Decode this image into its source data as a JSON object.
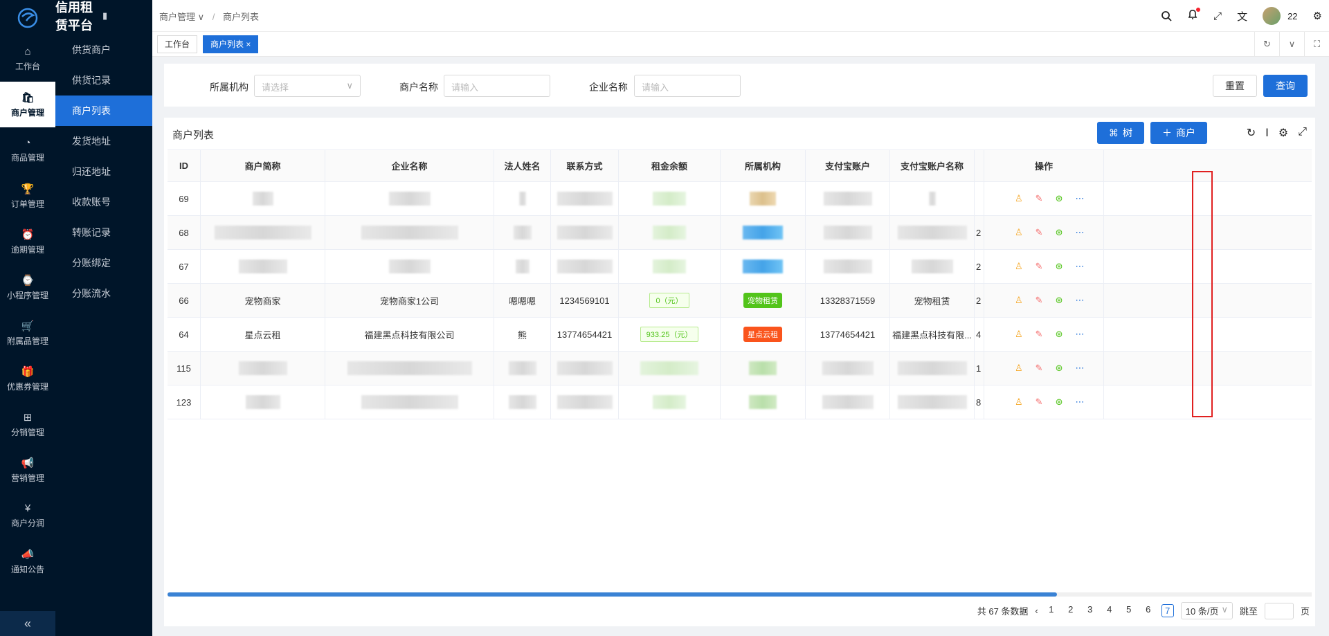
{
  "app": {
    "title": "信用租赁平台"
  },
  "sidebar": {
    "items": [
      {
        "label": "工作台"
      },
      {
        "label": "商户管理",
        "active": true
      },
      {
        "label": "商品管理"
      },
      {
        "label": "订单管理"
      },
      {
        "label": "逾期管理"
      },
      {
        "label": "小程序管理"
      },
      {
        "label": "附属品管理"
      },
      {
        "label": "优惠券管理"
      },
      {
        "label": "分销管理"
      },
      {
        "label": "营销管理"
      },
      {
        "label": "商户分润"
      },
      {
        "label": "通知公告"
      }
    ],
    "collapse": "«"
  },
  "submenu": {
    "items": [
      "供货商户",
      "供货记录",
      "商户列表",
      "发货地址",
      "归还地址",
      "收款账号",
      "转账记录",
      "分账绑定",
      "分账流水"
    ],
    "active_index": 2
  },
  "header": {
    "breadcrumb": [
      "商户管理",
      "商户列表"
    ],
    "user": "22"
  },
  "tabs": [
    {
      "label": "工作台",
      "active": false
    },
    {
      "label": "商户列表",
      "active": true,
      "close": "×"
    }
  ],
  "search": {
    "org_label": "所属机构",
    "org_placeholder": "请选择",
    "name_label": "商户名称",
    "name_placeholder": "请输入",
    "company_label": "企业名称",
    "company_placeholder": "请输入",
    "reset": "重置",
    "query": "查询"
  },
  "card": {
    "title": "商户列表",
    "tree_btn": "树",
    "add_btn": "商户"
  },
  "table": {
    "headers": [
      "ID",
      "商户简称",
      "企业名称",
      "法人姓名",
      "联系方式",
      "租金余额",
      "所属机构",
      "支付宝账户",
      "支付宝账户名称",
      "",
      "操作"
    ],
    "rows": [
      {
        "id": "69",
        "name": "",
        "company": "",
        "legal": "",
        "contact": "",
        "balance": "",
        "org": "",
        "alipay": "",
        "alipay_name": "",
        "extra": ""
      },
      {
        "id": "68",
        "name": "",
        "company": "",
        "legal": "",
        "contact": "",
        "balance": "",
        "org": "",
        "alipay": "",
        "alipay_name": "",
        "extra": "2"
      },
      {
        "id": "67",
        "name": "",
        "company": "",
        "legal": "",
        "contact": "",
        "balance": "",
        "org": "",
        "alipay": "",
        "alipay_name": "",
        "extra": "2"
      },
      {
        "id": "66",
        "name": "宠物商家",
        "company": "宠物商家1公司",
        "legal": "嗯嗯嗯",
        "contact": "1234569101",
        "balance": "0（元）",
        "org": "宠物租赁",
        "alipay": "13328371559",
        "alipay_name": "宠物租赁",
        "extra": "2"
      },
      {
        "id": "64",
        "name": "星点云租",
        "company": "福建黑点科技有限公司",
        "legal": "熊",
        "contact": "13774654421",
        "balance": "933.25（元）",
        "org": "星点云租",
        "alipay": "13774654421",
        "alipay_name": "福建黑点科技有限...",
        "extra": "4"
      },
      {
        "id": "115",
        "name": "",
        "company": "",
        "legal": "",
        "contact": "",
        "balance": "",
        "org": "",
        "alipay": "",
        "alipay_name": "",
        "extra": "1"
      },
      {
        "id": "123",
        "name": "",
        "company": "",
        "legal": "",
        "contact": "",
        "balance": "",
        "org": "",
        "alipay": "",
        "alipay_name": "",
        "extra": "8"
      }
    ]
  },
  "pagination": {
    "total": "共 67 条数据",
    "pages": [
      "1",
      "2",
      "3",
      "4",
      "5",
      "6",
      "7"
    ],
    "current": "7",
    "size": "10 条/页",
    "jump": "跳至",
    "page_unit": "页"
  },
  "colors": {
    "primary": "#1e6fd9",
    "sidebar": "#001529",
    "highlight": "#e02020"
  }
}
